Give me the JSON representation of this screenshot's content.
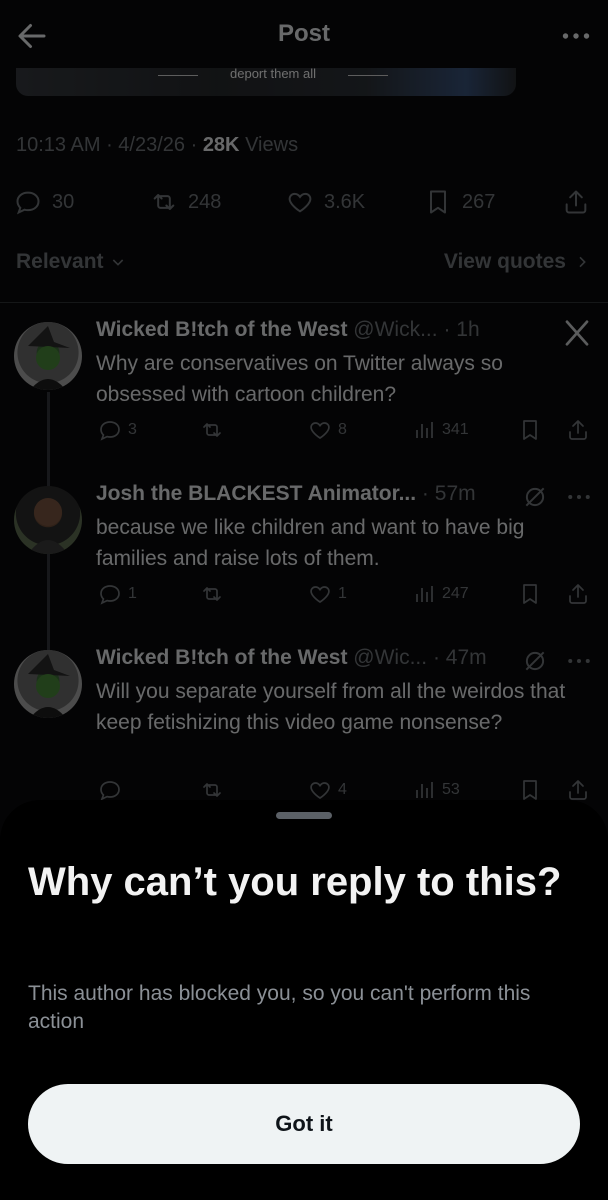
{
  "header": {
    "title": "Post"
  },
  "media": {
    "caption": "deport them all"
  },
  "post_meta": {
    "time": "10:13 AM",
    "date": "4/23/26",
    "views_count": "28K",
    "views_label": "Views"
  },
  "post_stats": {
    "replies": "30",
    "reposts": "248",
    "likes": "3.6K",
    "bookmarks": "267"
  },
  "sort": {
    "label": "Relevant",
    "quotes_label": "View quotes"
  },
  "tweets": [
    {
      "name": "Wicked B!tch of the West",
      "handle": "@Wick...",
      "time": "1h",
      "text": "Why are conservatives on Twitter always so obsessed with cartoon children?",
      "replies": "3",
      "likes": "8",
      "views": "341"
    },
    {
      "name": "Josh the BLACKEST Animator...",
      "handle": "",
      "time": "57m",
      "text": "because we like children and want to have big families and raise lots of them.",
      "replies": "1",
      "likes": "1",
      "views": "247"
    },
    {
      "name": "Wicked B!tch of the West",
      "handle": "@Wic...",
      "time": "47m",
      "text": "Will you separate yourself from all the weirdos that keep fetishizing this video game nonsense?",
      "replies": "",
      "likes": "4",
      "views": "53"
    }
  ],
  "sheet": {
    "title": "Why can’t you reply to this?",
    "message": "This author has blocked you, so you can't perform this action",
    "button": "Got it"
  },
  "colors": {
    "background": "#000000",
    "muted": "#71767b",
    "button_bg": "#eff3f4",
    "text": "#e7e9ea"
  }
}
